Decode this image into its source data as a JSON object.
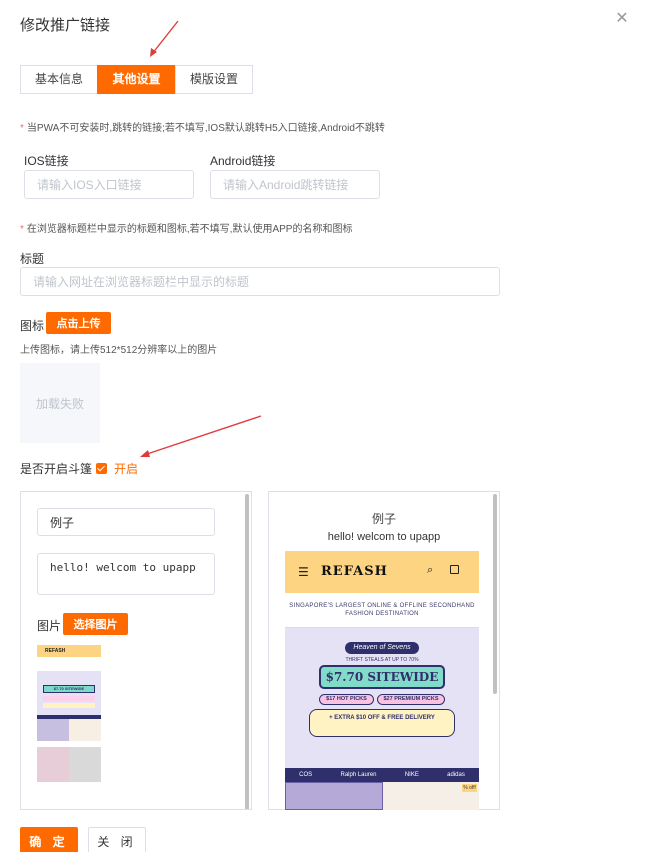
{
  "dialog": {
    "title": "修改推广链接",
    "close_icon": "close-icon"
  },
  "tabs": [
    {
      "label": "基本信息",
      "active": false
    },
    {
      "label": "其他设置",
      "active": true
    },
    {
      "label": "模版设置",
      "active": false
    }
  ],
  "pwa_note": "当PWA不可安装时,跳转的链接;若不填写,IOS默认跳转H5入口链接,Android不跳转",
  "ios": {
    "label": "IOS链接",
    "placeholder": "请输入IOS入口链接"
  },
  "android": {
    "label": "Android链接",
    "placeholder": "请输入Android跳转链接"
  },
  "browser_note": "在浏览器标题栏中显示的标题和图标,若不填写,默认使用APP的名称和图标",
  "title_field": {
    "label": "标题",
    "placeholder": "请输入网址在浏览器标题栏中显示的标题"
  },
  "icon_field": {
    "label": "图标",
    "upload_button": "点击上传",
    "hint": "上传图标，请上传512*512分辨率以上的图片",
    "broken_image": "加载失败"
  },
  "cloak": {
    "label": "是否开启斗篷",
    "checked": true,
    "checkbox_label": "开启"
  },
  "editor": {
    "example_value": "例子",
    "text_value": "hello! welcom to upapp",
    "image_label": "图片",
    "choose_button": "选择图片"
  },
  "preview": {
    "title": "例子",
    "subtitle": "hello! welcom to upapp",
    "site": {
      "logo": "REFASH",
      "tagline": "SINGAPORE'S LARGEST ONLINE & OFFLINE SECONDHAND FASHION DESTINATION",
      "event": "Heaven of Sevens",
      "event_sub": "THRIFT STEALS AT UP TO 70%",
      "banner_headline": "$7.70 SITEWIDE",
      "hot_picks": "$17 HOT PICKS",
      "premium_picks": "$27 PREMIUM PICKS",
      "extra": "+ EXTRA $10 OFF & FREE DELIVERY",
      "brands": [
        "COS",
        "Ralph Lauren",
        "NIKE",
        "adidas"
      ],
      "side_tag": "% off!"
    }
  },
  "footer": {
    "ok": "确 定",
    "cancel": "关 闭"
  },
  "colors": {
    "accent": "#ff6a00",
    "annotation": "#e03b3b",
    "banner_bg": "#fcd482"
  }
}
